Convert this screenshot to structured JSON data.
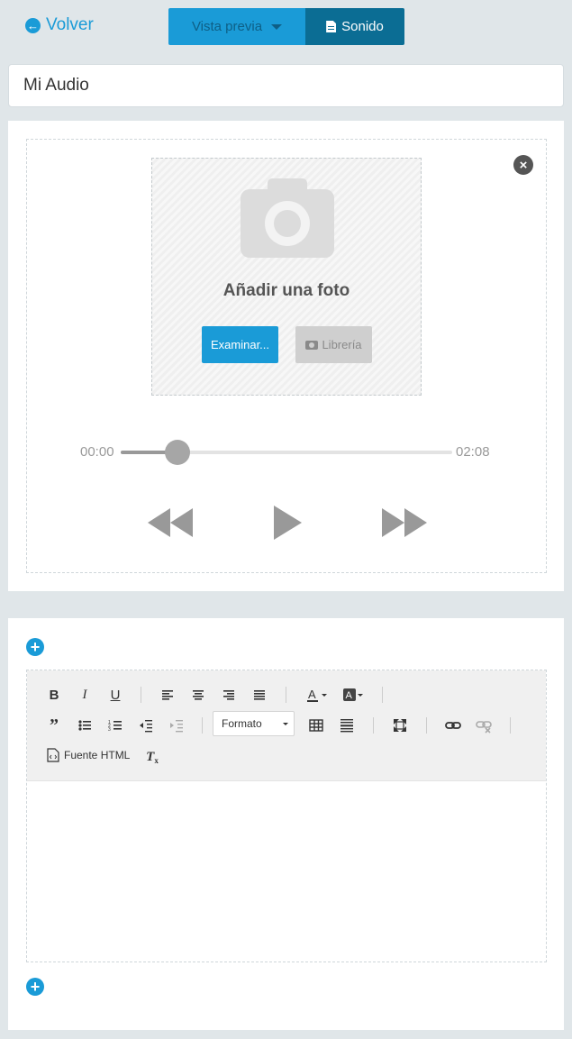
{
  "nav": {
    "back_label": "Volver"
  },
  "view_toggle": {
    "preview_label": "Vista previa",
    "sound_label": "Sonido"
  },
  "title_field": {
    "value": "Mi Audio"
  },
  "photo": {
    "label": "Añadir una foto",
    "browse_label": "Examinar...",
    "library_label": "Librería"
  },
  "player": {
    "current_time": "00:00",
    "duration": "02:08",
    "progress": 0.17
  },
  "editor": {
    "format_label": "Formato",
    "html_source_label": "Fuente HTML",
    "content": ""
  },
  "colors": {
    "accent": "#1a9bd7",
    "accent_dark": "#0b6d94",
    "background": "#e0e6e9"
  },
  "icons": [
    "arrow-left-circle-icon",
    "caret-down-icon",
    "file-icon",
    "close-circle-icon",
    "camera-icon",
    "rewind-icon",
    "play-icon",
    "fast-forward-icon",
    "plus-circle-icon"
  ]
}
